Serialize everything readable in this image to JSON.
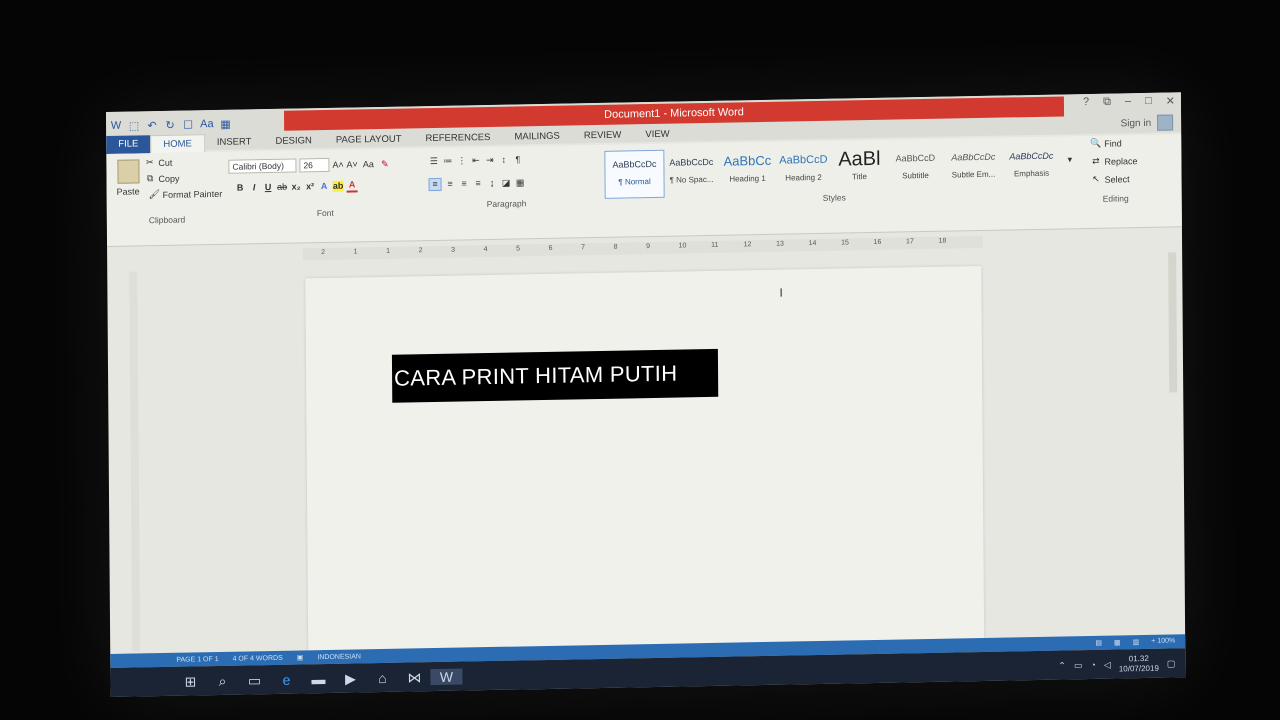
{
  "window": {
    "title": "Document1 - Microsoft Word",
    "signin": "Sign in",
    "controls": [
      "?",
      "⧉",
      "–",
      "□",
      "✕"
    ]
  },
  "qat": [
    "W",
    "⬚",
    "↶",
    "↻",
    "☐",
    "Aa",
    "▦"
  ],
  "tabs": [
    "FILE",
    "HOME",
    "INSERT",
    "DESIGN",
    "PAGE LAYOUT",
    "REFERENCES",
    "MAILINGS",
    "REVIEW",
    "VIEW"
  ],
  "clipboard": {
    "paste": "Paste",
    "cut": "Cut",
    "copy": "Copy",
    "format_painter": "Format Painter",
    "label": "Clipboard"
  },
  "font": {
    "name": "Calibri (Body)",
    "size": "26",
    "label": "Font",
    "grow": "A˄",
    "shrink": "A˅",
    "case": "Aa"
  },
  "paragraph": {
    "label": "Paragraph"
  },
  "styles": {
    "label": "Styles",
    "items": [
      {
        "preview": "AaBbCcDc",
        "name": "¶ Normal"
      },
      {
        "preview": "AaBbCcDc",
        "name": "¶ No Spac..."
      },
      {
        "preview": "AaBbCc",
        "name": "Heading 1"
      },
      {
        "preview": "AaBbCcD",
        "name": "Heading 2"
      },
      {
        "preview": "AaBl",
        "name": "Title"
      },
      {
        "preview": "AaBbCcD",
        "name": "Subtitle"
      },
      {
        "preview": "AaBbCcDc",
        "name": "Subtle Em..."
      },
      {
        "preview": "AaBbCcDc",
        "name": "Emphasis"
      }
    ]
  },
  "editing": {
    "find": "Find",
    "replace": "Replace",
    "select": "Select",
    "label": "Editing"
  },
  "ruler": [
    "2",
    "1",
    "1",
    "2",
    "3",
    "4",
    "5",
    "6",
    "7",
    "8",
    "9",
    "10",
    "11",
    "12",
    "13",
    "14",
    "15",
    "16",
    "17",
    "18"
  ],
  "document": {
    "banner": "CARA PRINT HITAM PUTIH"
  },
  "status": {
    "page": "PAGE 1 OF 1",
    "words": "4 OF 4 WORDS",
    "language": "INDONESIAN",
    "zoom": "+ 100%"
  },
  "taskbar": {
    "time": "01.32",
    "date": "10/07/2019"
  }
}
